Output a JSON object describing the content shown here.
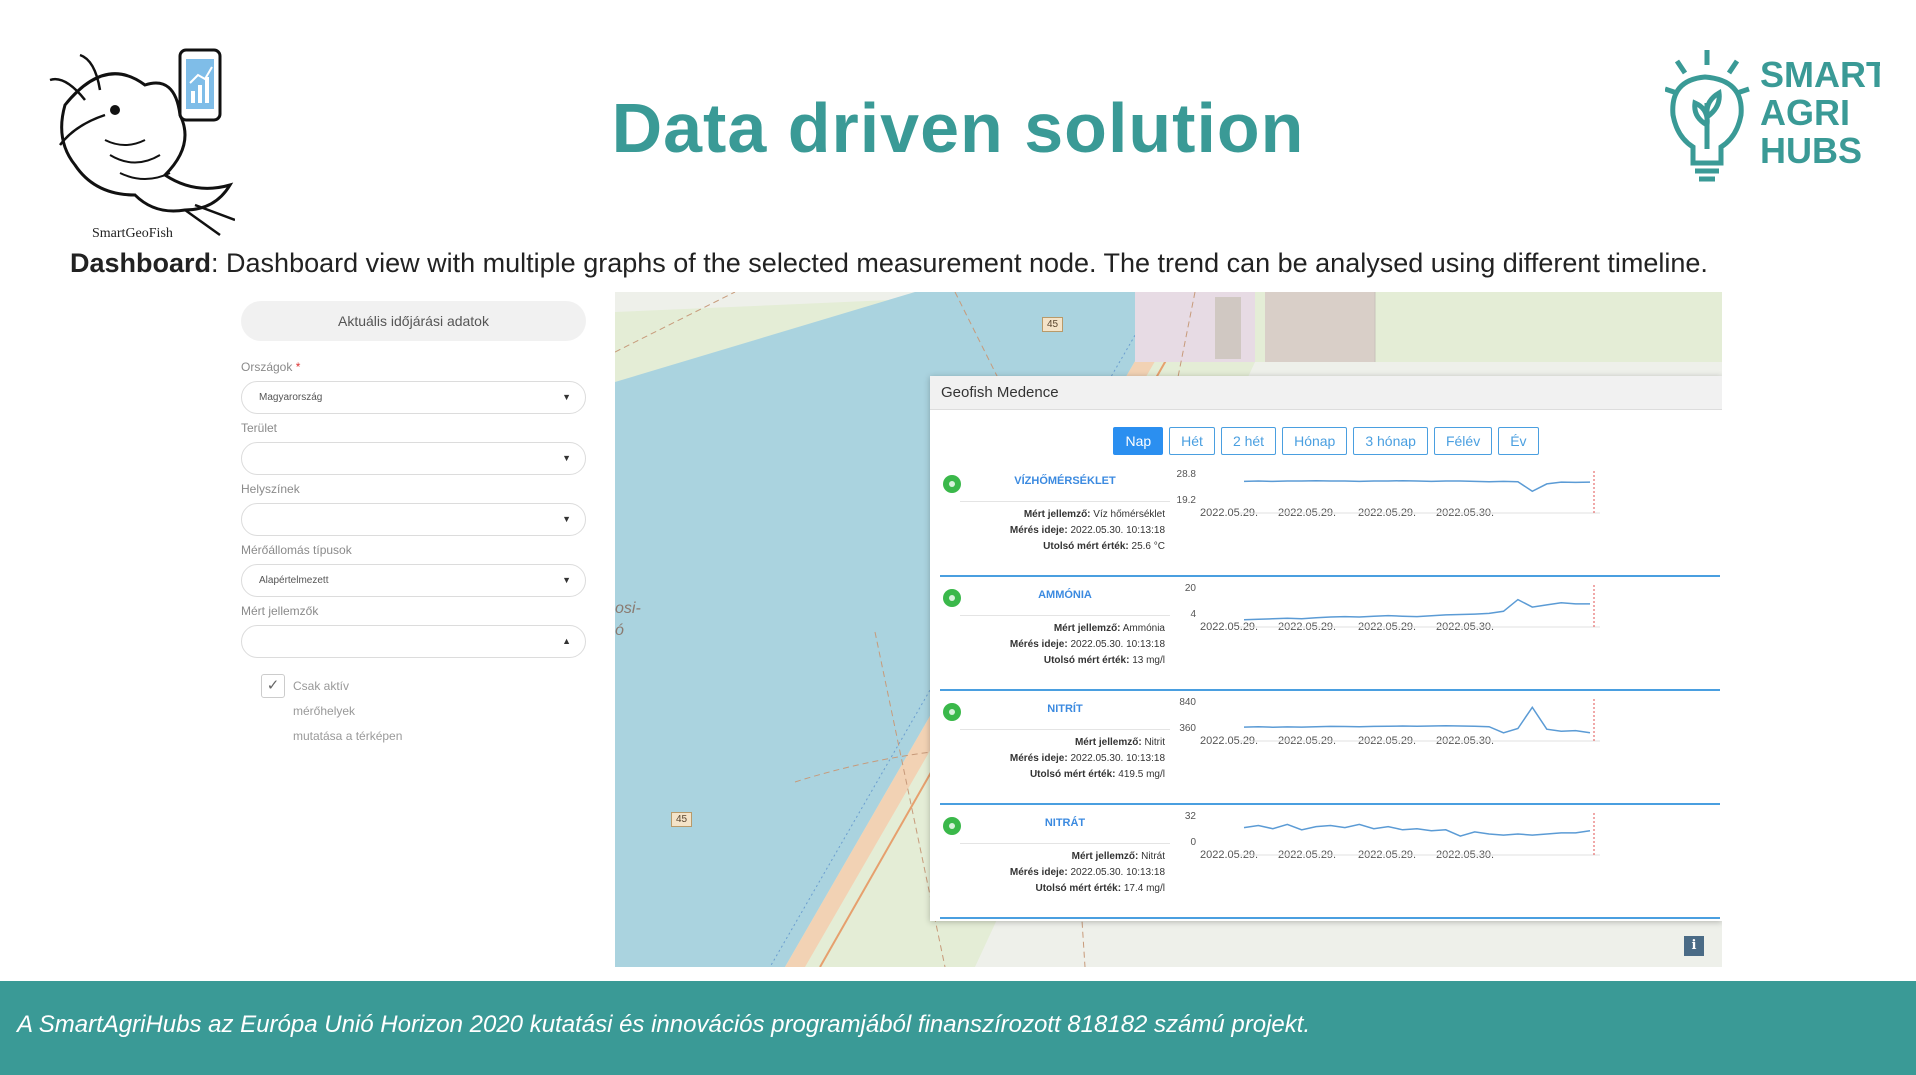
{
  "slide": {
    "title": "Data driven solution",
    "left_logo_caption": "SmartGeoFish",
    "right_logo_lines": [
      "SMART",
      "AGRI",
      "HUBS"
    ],
    "subtitle_bold": "Dashboard",
    "subtitle_rest": ": Dashboard view with multiple graphs of the selected measurement node. The trend can be analysed using different timeline.",
    "footer": "A SmartAgriHubs az Európa Unió Horizon 2020 kutatási és innovációs programjából finanszírozott 818182 számú projekt.",
    "colors": {
      "teal": "#3a9a96",
      "accent_blue": "#2b8ff0",
      "status_green": "#3ab84a"
    }
  },
  "filters": {
    "weather_button": "Aktuális időjárási adatok",
    "country_label": "Országok",
    "country_required": "*",
    "country_value": "Magyarország",
    "area_label": "Terület",
    "area_value": "",
    "location_label": "Helyszínek",
    "location_value": "",
    "station_type_label": "Mérőállomás típusok",
    "station_type_value": "Alapértelmezett",
    "measured_label": "Mért jellemzők",
    "measured_value": "",
    "active_only_checked": true,
    "active_only_label": "Csak aktív mérőhelyek mutatása a térképen"
  },
  "map": {
    "road_number": "45",
    "place_fragment_1": "osi-",
    "place_fragment_2": "ó",
    "info_button": "i"
  },
  "panel": {
    "title": "Geofish Medence",
    "tabs": [
      "Nap",
      "Hét",
      "2 hét",
      "Hónap",
      "3 hónap",
      "Félév",
      "Év"
    ],
    "active_tab": "Nap",
    "measured_prefix": "Mért jellemző:",
    "time_prefix": "Mérés ideje:",
    "last_prefix": "Utolsó mért érték:",
    "metrics": [
      {
        "name": "VÍZHŐMÉRSÉKLET",
        "measured": "Víz hőmérséklet",
        "time": "2022.05.30. 10:13:18",
        "last": "25.6 °C",
        "y_max": "28.8",
        "y_min": "19.2",
        "dates": [
          "2022.05.29.",
          "2022.05.29.",
          "2022.05.29.",
          "2022.05.30."
        ],
        "series": [
          27.0,
          27.1,
          27.0,
          27.1,
          27.1,
          27.2,
          27.1,
          27.1,
          27.0,
          27.1,
          27.1,
          27.2,
          27.1,
          27.0,
          27.1,
          27.1,
          27.0,
          26.9,
          27.0,
          26.9,
          24.2,
          26.3,
          26.8,
          26.7,
          26.8
        ]
      },
      {
        "name": "AMMÓNIA",
        "measured": "Ammónia",
        "time": "2022.05.30. 10:13:18",
        "last": "13 mg/l",
        "y_max": "20",
        "y_min": "4",
        "dates": [
          "2022.05.29.",
          "2022.05.29.",
          "2022.05.29.",
          "2022.05.30."
        ],
        "series": [
          5.5,
          5.8,
          6.0,
          6.2,
          6.0,
          6.5,
          6.8,
          7.0,
          6.8,
          7.2,
          7.5,
          7.2,
          7.0,
          7.4,
          7.8,
          8.0,
          8.2,
          8.5,
          9.5,
          15.0,
          11.5,
          12.5,
          13.5,
          13.0,
          13.0
        ]
      },
      {
        "name": "NITRÍT",
        "measured": "Nitrit",
        "time": "2022.05.30. 10:13:18",
        "last": "419.5 mg/l",
        "y_max": "840",
        "y_min": "360",
        "dates": [
          "2022.05.29.",
          "2022.05.29.",
          "2022.05.29.",
          "2022.05.30."
        ],
        "series": [
          500,
          505,
          498,
          502,
          500,
          505,
          510,
          508,
          505,
          510,
          512,
          515,
          512,
          515,
          518,
          515,
          512,
          505,
          420,
          480,
          780,
          470,
          440,
          450,
          420
        ]
      },
      {
        "name": "NITRÁT",
        "measured": "Nitrát",
        "time": "2022.05.30. 10:13:18",
        "last": "17.4 mg/l",
        "y_max": "32",
        "y_min": "0",
        "dates": [
          "2022.05.29.",
          "2022.05.29.",
          "2022.05.29.",
          "2022.05.30."
        ],
        "series": [
          22,
          24,
          21,
          25,
          20,
          23,
          24,
          22,
          25,
          21,
          23,
          20,
          21,
          19,
          20,
          14,
          18,
          16,
          15,
          16,
          15,
          16,
          17,
          17,
          19
        ]
      }
    ]
  }
}
